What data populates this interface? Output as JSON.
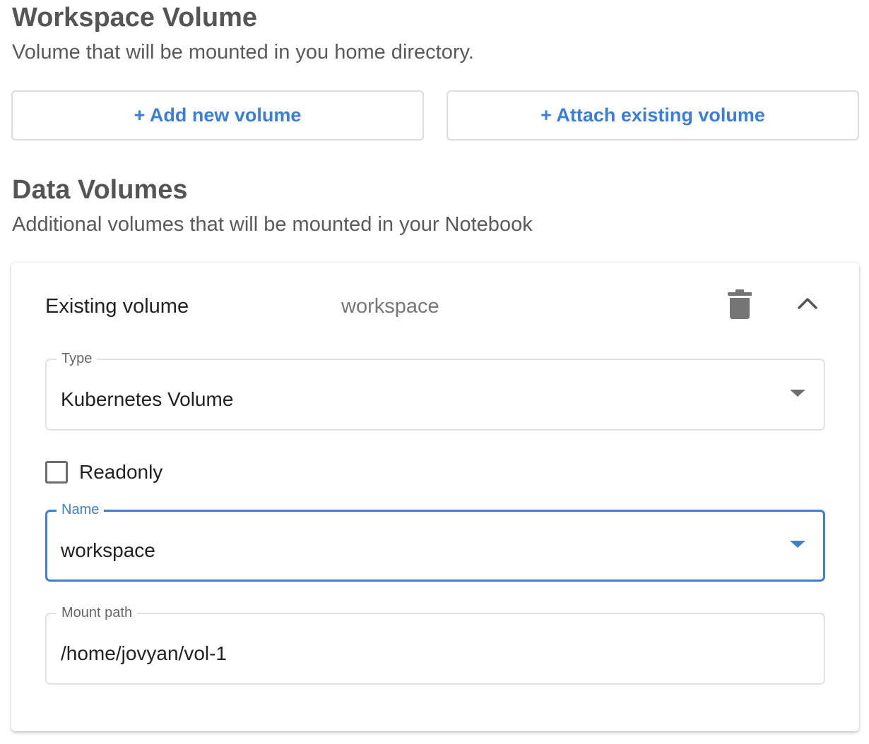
{
  "workspace": {
    "title": "Workspace Volume",
    "subtitle": "Volume that will be mounted in you home directory.",
    "add_button": "+ Add new volume",
    "attach_button": "+ Attach existing volume"
  },
  "data_volumes": {
    "title": "Data Volumes",
    "subtitle": "Additional volumes that will be mounted in your Notebook",
    "card": {
      "header_label": "Existing volume",
      "header_name": "workspace",
      "icons": [
        "delete-icon",
        "chevron-up-icon"
      ],
      "type_field": {
        "label": "Type",
        "value": "Kubernetes Volume"
      },
      "readonly": {
        "label": "Readonly",
        "checked": false
      },
      "name_field": {
        "label": "Name",
        "value": "workspace",
        "focused": true
      },
      "mount_field": {
        "label": "Mount path",
        "value": "/home/jovyan/vol-1"
      }
    }
  },
  "colors": {
    "accent": "#3a7fd5",
    "heading": "#555555",
    "border": "#dcdcdc"
  }
}
